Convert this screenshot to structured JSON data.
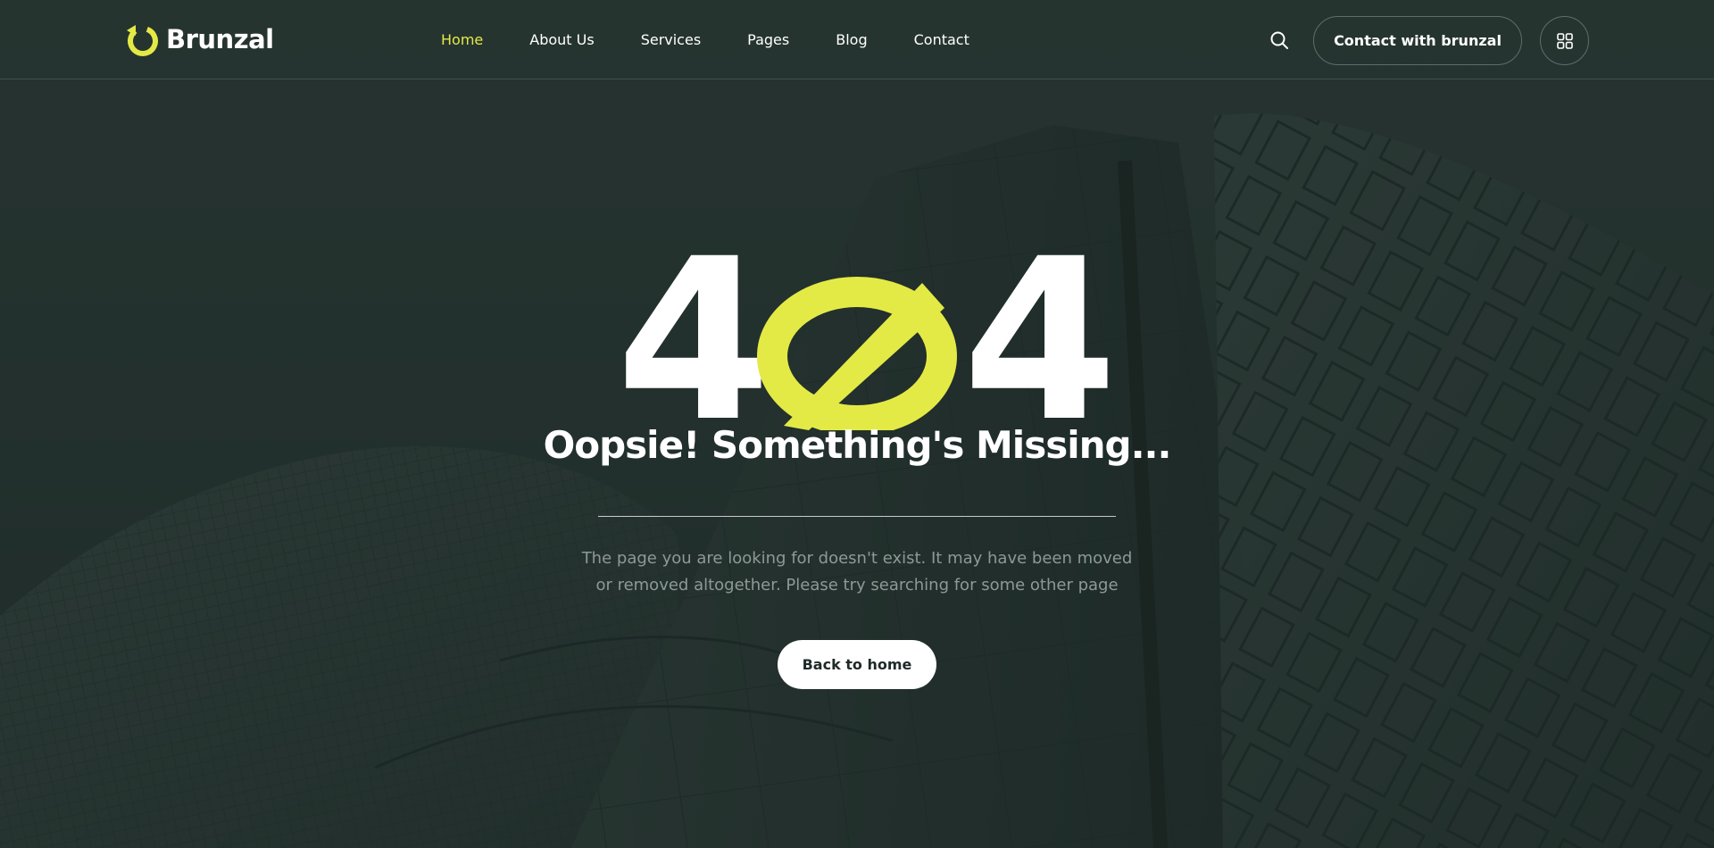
{
  "brand": {
    "name": "Brunzal",
    "logo_icon": "refresh-ring-icon",
    "accent_color": "#e4ea45"
  },
  "nav": {
    "items": [
      {
        "label": "Home",
        "active": true
      },
      {
        "label": "About Us",
        "active": false
      },
      {
        "label": "Services",
        "active": false
      },
      {
        "label": "Pages",
        "active": false
      },
      {
        "label": "Blog",
        "active": false
      },
      {
        "label": "Contact",
        "active": false
      }
    ]
  },
  "header_actions": {
    "search_icon": "search-icon",
    "contact_label": "Contact with brunzal",
    "menu_icon": "grid-icon"
  },
  "error": {
    "digit_left": "4",
    "digit_right": "4",
    "zero_icon": "broken-zero-icon",
    "heading": "Oopsie! Something's Missing...",
    "description": "The page you are looking for doesn't exist. It may have been moved\nor  removed altogether. Please try searching for some other page",
    "back_label": "Back to home"
  },
  "colors": {
    "background": "#263532",
    "text": "#ffffff",
    "muted_text": "#8d9995"
  }
}
